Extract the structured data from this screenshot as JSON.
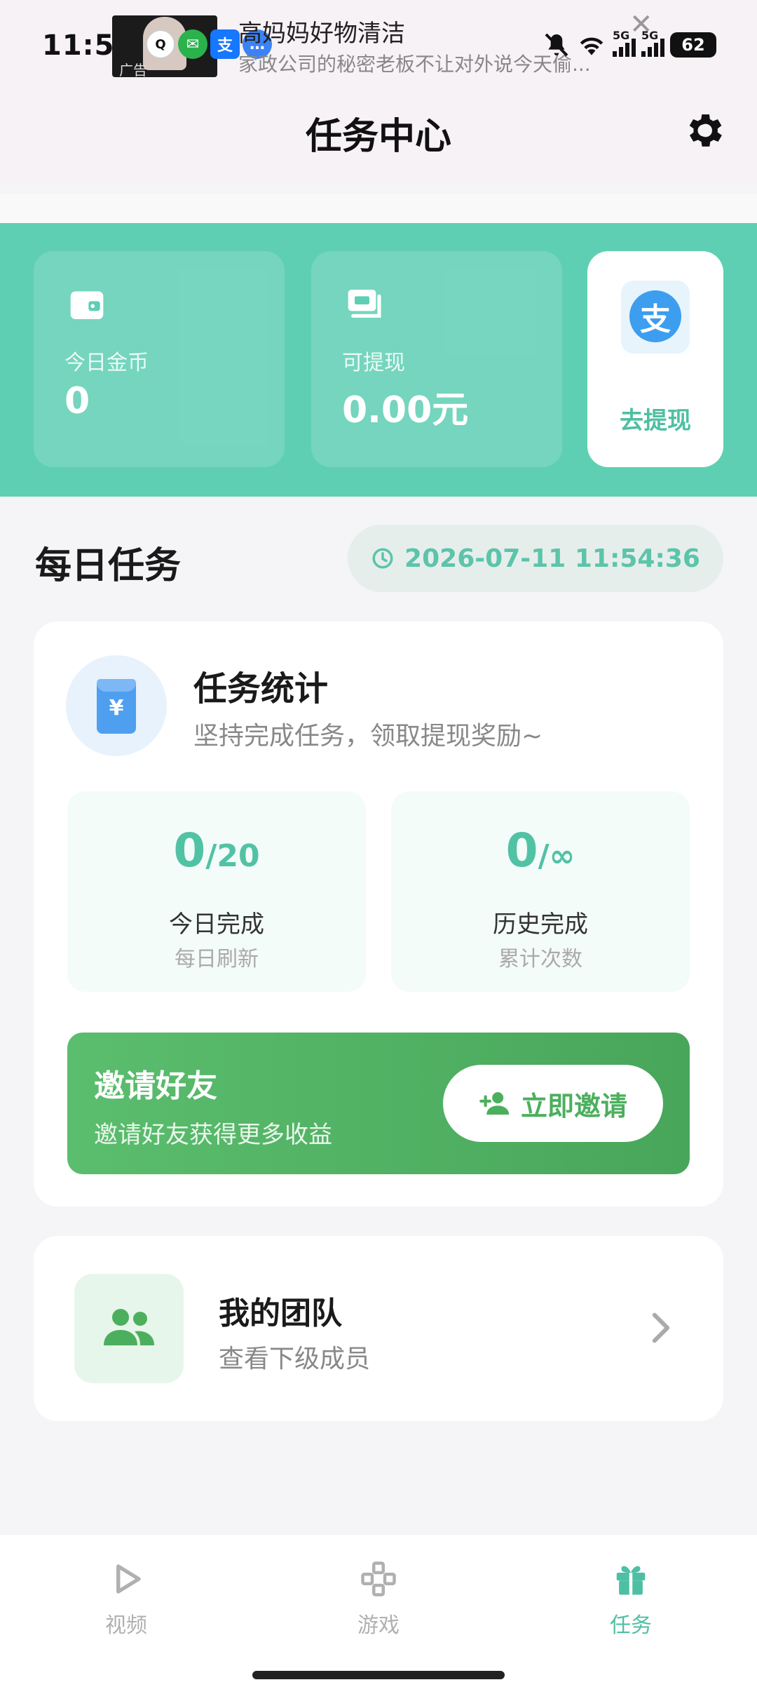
{
  "status_bar": {
    "time": "11:54",
    "battery": "62",
    "signal_labels": [
      "5G",
      "5G"
    ]
  },
  "notification": {
    "thumb_tag": "广告",
    "app_icons": [
      "qq-icon",
      "wechat-icon",
      "alipay-icon",
      "message-icon"
    ],
    "title": "高妈妈好物清洁",
    "subtitle": "家政公司的秘密老板不让对外说今天偷..."
  },
  "header": {
    "title": "任务中心",
    "settings_icon": "gear-icon"
  },
  "wallet": {
    "today_coins_label": "今日金币",
    "today_coins_value": "0",
    "withdrawable_label": "可提现",
    "withdrawable_value": "0.00元",
    "withdraw_button_label": "去提现",
    "alipay_glyph": "支"
  },
  "daily_tasks": {
    "title": "每日任务",
    "datetime": "2026-07-11 11:54:36"
  },
  "task_stats": {
    "title": "任务统计",
    "subtitle": "坚持完成任务，领取提现奖励~",
    "today": {
      "count": "0",
      "total": "/20",
      "label": "今日完成",
      "hint": "每日刷新"
    },
    "history": {
      "count": "0",
      "total": "/∞",
      "label": "历史完成",
      "hint": "累计次数"
    }
  },
  "invite": {
    "title": "邀请好友",
    "subtitle": "邀请好友获得更多收益",
    "button_label": "立即邀请"
  },
  "team": {
    "title": "我的团队",
    "subtitle": "查看下级成员"
  },
  "bottom_nav": {
    "items": [
      {
        "label": "视频",
        "icon": "play-icon",
        "active": false
      },
      {
        "label": "游戏",
        "icon": "gamepad-icon",
        "active": false
      },
      {
        "label": "任务",
        "icon": "gift-icon",
        "active": true
      }
    ]
  },
  "colors": {
    "accent": "#5fcfb4",
    "accent_text": "#52c2a5",
    "invite_green": "#4caf5e",
    "alipay_blue": "#3d9ef0"
  }
}
